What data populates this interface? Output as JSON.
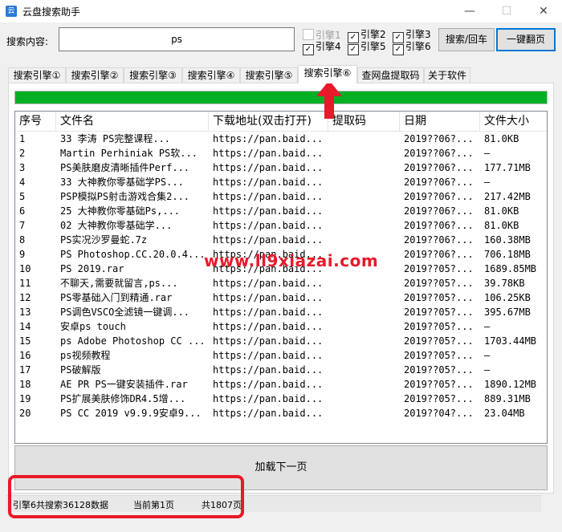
{
  "window": {
    "title": "云盘搜索助手",
    "app_icon": "云",
    "minimize": "—",
    "maximize": "☐",
    "close": "✕"
  },
  "search": {
    "label": "搜索内容:",
    "value": "ps"
  },
  "engines": [
    {
      "label": "引擎1",
      "checked": false,
      "enabled": false
    },
    {
      "label": "引擎2",
      "checked": true,
      "enabled": true
    },
    {
      "label": "引擎3",
      "checked": true,
      "enabled": true
    },
    {
      "label": "引擎4",
      "checked": true,
      "enabled": true
    },
    {
      "label": "引擎5",
      "checked": true,
      "enabled": true
    },
    {
      "label": "引擎6",
      "checked": true,
      "enabled": true
    }
  ],
  "buttons": {
    "search": "搜索/回车",
    "flip_page": "一键翻页",
    "load_next": "加载下一页"
  },
  "tabs": [
    {
      "label": "搜索引擎①"
    },
    {
      "label": "搜索引擎②"
    },
    {
      "label": "搜索引擎③"
    },
    {
      "label": "搜索引擎④"
    },
    {
      "label": "搜索引擎⑤"
    },
    {
      "label": "搜索引擎⑥"
    },
    {
      "label": "查网盘提取码"
    },
    {
      "label": "关于软件"
    }
  ],
  "active_tab": 5,
  "progress": 1.0,
  "colors": {
    "progress": "#06b025",
    "annotation": "#e8192a",
    "focus": "#0078d7"
  },
  "table": {
    "columns": [
      "序号",
      "文件名",
      "下载地址(双击打开)",
      "提取码",
      "日期",
      "文件大小"
    ],
    "rows": [
      [
        "1",
        "33   李涛  PS完整课程...",
        "https://pan.baid...",
        "",
        "2019??06?...",
        "81.0KB"
      ],
      [
        "2",
        "Martin Perhiniak PS软...",
        "https://pan.baid...",
        "",
        "2019??06?...",
        "—"
      ],
      [
        "3",
        "PS美肤磨皮清晰插件Perf...",
        "https://pan.baid...",
        "",
        "2019??06?...",
        "177.71MB"
      ],
      [
        "4",
        "33 大神教你零基础学PS...",
        "https://pan.baid...",
        "",
        "2019??06?...",
        "—"
      ],
      [
        "5",
        "PSP模拟PS射击游戏合集2...",
        "https://pan.baid...",
        "",
        "2019??06?...",
        "217.42MB"
      ],
      [
        "6",
        "25  大神教你零基础Ps,...",
        "https://pan.baid...",
        "",
        "2019??06?...",
        "81.0KB"
      ],
      [
        "7",
        "02     大神教你零基础学...",
        "https://pan.baid...",
        "",
        "2019??06?...",
        "81.0KB"
      ],
      [
        "8",
        "PS实况沙罗曼蛇.7z",
        "https://pan.baid...",
        "",
        "2019??06?...",
        "160.38MB"
      ],
      [
        "9",
        "PS Photoshop.CC.20.0.4...",
        "https://pan.baid...",
        "",
        "2019??06?...",
        "706.18MB"
      ],
      [
        "10",
        "PS 2019.rar",
        "https://pan.baid...",
        "",
        "2019??05?...",
        "1689.85MB"
      ],
      [
        "11",
        "不聊天,需要就留言,ps...",
        "https://pan.baid...",
        "",
        "2019??05?...",
        "39.78KB"
      ],
      [
        "12",
        "PS零基础入门到精通.rar",
        "https://pan.baid...",
        "",
        "2019??05?...",
        "106.25KB"
      ],
      [
        "13",
        "PS调色VSCO全滤镜一键调...",
        "https://pan.baid...",
        "",
        "2019??05?...",
        "395.67MB"
      ],
      [
        "14",
        "安卓ps touch",
        "https://pan.baid...",
        "",
        "2019??05?...",
        "—"
      ],
      [
        "15",
        "ps Adobe Photoshop CC ...",
        "https://pan.baid...",
        "",
        "2019??05?...",
        "1703.44MB"
      ],
      [
        "16",
        "ps视频教程",
        "https://pan.baid...",
        "",
        "2019??05?...",
        "—"
      ],
      [
        "17",
        "PS破解版",
        "https://pan.baid...",
        "",
        "2019??05?...",
        "—"
      ],
      [
        "18",
        "AE PR PS一键安装插件.rar",
        "https://pan.baid...",
        "",
        "2019??05?...",
        "1890.12MB"
      ],
      [
        "19",
        "PS扩展美肤修饰DR4.5增...",
        "https://pan.baid...",
        "",
        "2019??05?...",
        "889.31MB"
      ],
      [
        "20",
        "PS CC 2019 v9.9.9安卓9...",
        "https://pan.baid...",
        "",
        "2019??04?...",
        "23.04MB"
      ]
    ]
  },
  "status": {
    "total": "引擎6共搜索36128数据",
    "current_page": "当前第1页",
    "total_pages": "共1807页"
  },
  "watermark": "www.ll9xiazai.com"
}
